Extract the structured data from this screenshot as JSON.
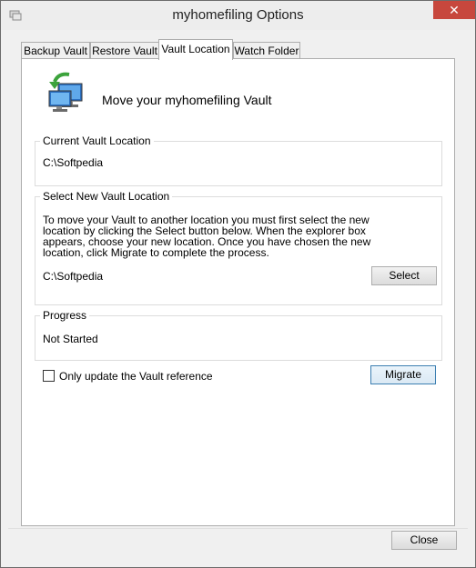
{
  "window": {
    "title": "myhomefiling Options",
    "close_glyph": "✕"
  },
  "tabs": [
    {
      "label": "Backup Vault",
      "active": false
    },
    {
      "label": "Restore Vault",
      "active": false
    },
    {
      "label": "Vault Location",
      "active": true
    },
    {
      "label": "Watch Folder",
      "active": false
    }
  ],
  "header": {
    "title": "Move your myhomefiling Vault",
    "icon": "network-computer-icon"
  },
  "current_location": {
    "label": "Current Vault Location",
    "value": "C:\\Softpedia"
  },
  "new_location": {
    "label": "Select New Vault Location",
    "description": "To move your Vault to another location you must first select the new location by clicking the Select button below.  When the explorer box appears, choose your new location.  Once you have chosen the new location, click Migrate to complete the process.",
    "value": "C:\\Softpedia",
    "select_button": "Select"
  },
  "progress": {
    "label": "Progress",
    "status": "Not Started"
  },
  "options": {
    "only_update_label": "Only update the Vault reference",
    "only_update_checked": false
  },
  "migrate_button": "Migrate",
  "close_button": "Close"
}
